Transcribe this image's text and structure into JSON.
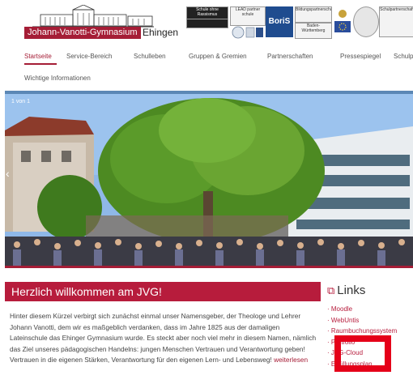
{
  "header": {
    "logo_name": "Johann-Vanotti-Gymnasium",
    "logo_city": "Ehingen",
    "partners": [
      "Schule ohne Rassismus",
      "LEAD partner schule",
      "BoriS",
      "Bildungspartnerschaft",
      "Baden-Württemberg",
      "EU",
      "Schulpartnerschaft"
    ]
  },
  "nav": {
    "items": [
      "Startseite",
      "Service-Bereich",
      "Schulleben",
      "Gruppen & Gremien",
      "Partnerschaften",
      "Pressespiegel",
      "Schulp"
    ],
    "second_row": "Wichtige Informationen"
  },
  "slider": {
    "counter": "1 von 1",
    "prev_arrow": "‹"
  },
  "welcome": {
    "title": "Herzlich willkommen am JVG!",
    "text": "Hinter diesem Kürzel verbirgt sich zunächst einmal unser Namensgeber, der Theologe und Lehrer Johann Vanotti, dem wir es maßgeblich verdanken, dass im Jahre 1825 aus der damaligen Lateinschule das Ehinger Gymnasium wurde. Es steckt aber noch viel mehr in diesem Namen, nämlich das Ziel unseres pädagogischen Handelns: jungen Menschen Vertrauen und Verantwortung geben! Vertrauen in die eigenen Stärken, Verantwortung für den eigenen Lern- und Lebensweg!",
    "more": "weiterlesen"
  },
  "links": {
    "title": "Links",
    "items": [
      "Moodle",
      "WebUntis",
      "Raumbuchungssystem",
      "Portfolio",
      "JVG-Cloud",
      "Erfüllungsplan..."
    ]
  },
  "colors": {
    "brand": "#a51d36",
    "highlight": "#e50019",
    "bluebar": "#5b87b5"
  }
}
